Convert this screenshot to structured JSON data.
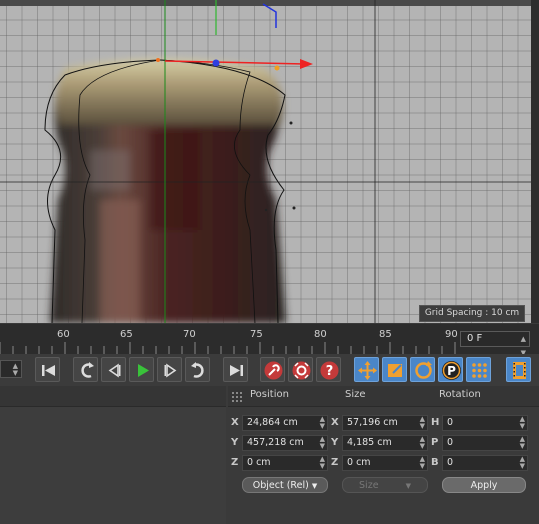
{
  "viewport": {
    "grid_spacing": "Grid Spacing : 10 cm"
  },
  "timeline": {
    "ticks": [
      "60",
      "65",
      "70",
      "75",
      "80",
      "85",
      "90"
    ],
    "current_frame": "0 F"
  },
  "transport": {
    "buttons": [
      "go-to-start",
      "play-backward",
      "step-backward",
      "play-forward",
      "step-forward",
      "go-to-next-key",
      "go-to-end",
      "record",
      "autokey",
      "keyframe-selection",
      "move-tool",
      "scale-tool",
      "rotate-tool",
      "parameter-tool",
      "point-level-animation",
      "timeline-film"
    ]
  },
  "coordinates": {
    "position_header": "Position",
    "size_header": "Size",
    "rotation_header": "Rotation",
    "rows": [
      {
        "axis": "X",
        "pos": "24,864 cm",
        "size_axis": "X",
        "size": "57,196 cm",
        "rot_axis": "H",
        "rot": "0"
      },
      {
        "axis": "Y",
        "pos": "457,218 cm",
        "size_axis": "Y",
        "size": "4,185 cm",
        "rot_axis": "P",
        "rot": "0"
      },
      {
        "axis": "Z",
        "pos": "0 cm",
        "size_axis": "Z",
        "size": "0 cm",
        "rot_axis": "B",
        "rot": "0"
      }
    ],
    "mode_select": "Object (Rel)",
    "size_select": "Size",
    "apply_label": "Apply"
  },
  "colors": {
    "accent": "#4a86c8",
    "play_green": "#39c23a",
    "record_red": "#c43a3a"
  }
}
